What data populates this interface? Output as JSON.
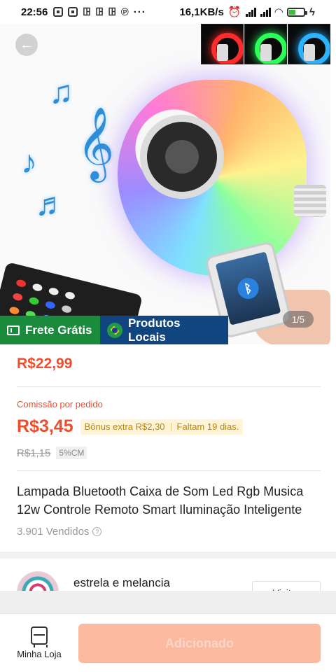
{
  "status_bar": {
    "time": "22:56",
    "net_speed": "16,1KB/s"
  },
  "hero": {
    "image_counter": "1/5"
  },
  "badges": {
    "free_shipping": "Frete Grátis",
    "local_products": "Produtos Locais"
  },
  "product": {
    "price": "R$22,99",
    "commission_label": "Comissão por pedido",
    "commission_value": "R$3,45",
    "bonus_text": "Bônus extra R$2,30",
    "days_left": "Faltam 19 dias.",
    "old_commission": "R$1,15",
    "commission_rate": "5%CM",
    "title": "Lampada Bluetooth Caixa de Som Led Rgb Musica 12w Controle Remoto Smart Iluminação Inteligente",
    "sold": "3.901 Vendidos"
  },
  "shop": {
    "name": "estrela e melancia",
    "visit_label": "Visitar"
  },
  "bottom_bar": {
    "store_label": "Minha Loja",
    "add_label": "Adicionado"
  },
  "colors": {
    "accent": "#ee4d2d",
    "free_shipping_bg": "#1a8a3d",
    "local_products_bg": "#10457f",
    "add_button_bg": "#fbb99f"
  }
}
